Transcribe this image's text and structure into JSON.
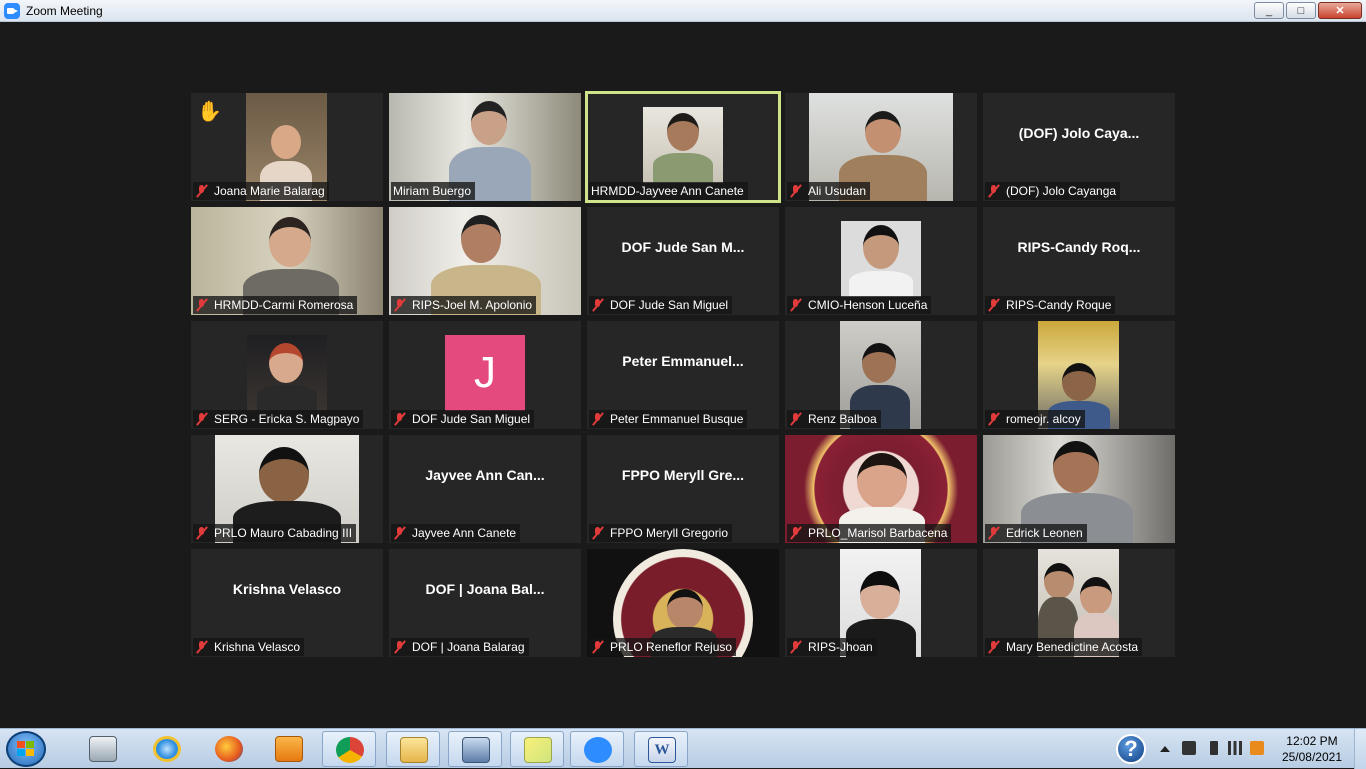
{
  "window": {
    "title": "Zoom Meeting",
    "minimize": "_",
    "maximize": "□",
    "close": "✕"
  },
  "participants": [
    {
      "name": "Joana Marie Balarag",
      "muted": true,
      "video": true,
      "raised_hand": true
    },
    {
      "name": "Miriam Buergo",
      "muted": false,
      "video": true
    },
    {
      "name": "HRMDD-Jayvee Ann Canete",
      "muted": false,
      "video": true,
      "active_speaker": true
    },
    {
      "name": "Ali Usudan",
      "muted": true,
      "video": true
    },
    {
      "name": "(DOF) Jolo Cayanga",
      "muted": true,
      "video": false,
      "display": "(DOF) Jolo Caya..."
    },
    {
      "name": "HRMDD-Carmi Romerosa",
      "muted": true,
      "video": true
    },
    {
      "name": "RIPS-Joel M. Apolonio",
      "muted": true,
      "video": true
    },
    {
      "name": "DOF Jude San Miguel",
      "muted": true,
      "video": false,
      "display": "DOF Jude San M..."
    },
    {
      "name": "CMIO-Henson Luceña",
      "muted": true,
      "video": true
    },
    {
      "name": "RIPS-Candy Roque",
      "muted": true,
      "video": false,
      "display": "RIPS-Candy  Roq..."
    },
    {
      "name": "SERG - Ericka S. Magpayo",
      "muted": true,
      "video": true
    },
    {
      "name": "DOF Jude San Miguel",
      "muted": true,
      "video": false,
      "avatar_letter": "J"
    },
    {
      "name": "Peter Emmanuel  Busque",
      "muted": true,
      "video": false,
      "display": "Peter  Emmanuel..."
    },
    {
      "name": "Renz Balboa",
      "muted": true,
      "video": true
    },
    {
      "name": "romeojr. alcoy",
      "muted": true,
      "video": true
    },
    {
      "name": "PRLO Mauro Cabading III",
      "muted": true,
      "video": true
    },
    {
      "name": "Jayvee Ann Canete",
      "muted": true,
      "video": false,
      "display": "Jayvee Ann Can..."
    },
    {
      "name": "FPPO Meryll Gregorio",
      "muted": true,
      "video": false,
      "display": "FPPO  Meryll  Gre..."
    },
    {
      "name": "PRLO_Marisol Barbacena",
      "muted": true,
      "video": true
    },
    {
      "name": "Edrick Leonen",
      "muted": true,
      "video": true
    },
    {
      "name": "Krishna Velasco",
      "muted": true,
      "video": false,
      "display": "Krishna Velasco"
    },
    {
      "name": "DOF | Joana Balarag",
      "muted": true,
      "video": false,
      "display": "DOF | Joana Bal..."
    },
    {
      "name": "PRLO Reneflor Rejuso",
      "muted": true,
      "video": true
    },
    {
      "name": "RIPS-Jhoan",
      "muted": true,
      "video": true
    },
    {
      "name": "Mary Benedictine Acosta",
      "muted": true,
      "video": true
    }
  ],
  "taskbar": {
    "items": [
      "calculator",
      "internet-explorer",
      "firefox",
      "media-player",
      "chrome",
      "file-explorer",
      "remote-desktop",
      "sticky-notes",
      "zoom",
      "word"
    ],
    "clock_time": "12:02 PM",
    "clock_date": "25/08/2021",
    "help": "?"
  },
  "colors": {
    "active_border": "#cfe38a",
    "muted_mic": "#e23b3b",
    "avatar_j": "#e44a7d"
  }
}
